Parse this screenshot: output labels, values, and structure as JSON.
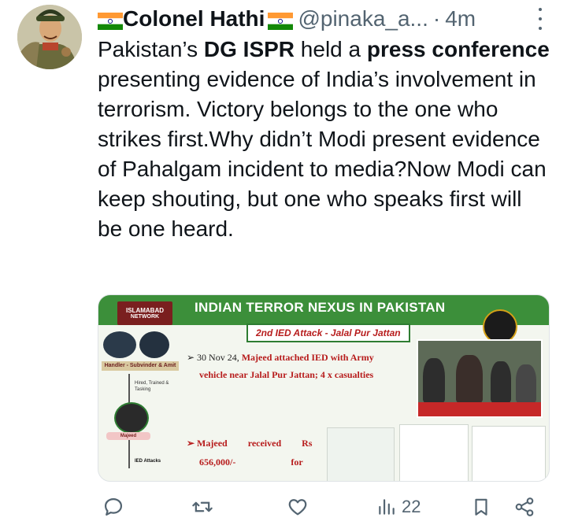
{
  "author": {
    "flag_left": "india-flag",
    "name": "Colonel Hathi",
    "flag_right": "india-flag",
    "handle": "@pinaka_a...",
    "separator": "·",
    "time": "4m"
  },
  "tweet": {
    "part1": "Pakistan’s ",
    "bold1": "DG ISPR",
    "part2": " held a ",
    "bold2": "press conference",
    "part3": " presenting evidence of India’s involvement in terrorism. Victory belongs to the one who strikes first.Why didn’t Modi present evidence of Pahalgam incident to media?Now Modi can keep shouting, but one who speaks first will be one heard."
  },
  "media": {
    "title": "INDIAN TERROR NEXUS IN PAKISTAN",
    "subtitle": "2nd IED Attack - Jalal Pur Jattan",
    "badge_line1": "ISLAMABAD",
    "badge_line2": "NETWORK",
    "handler_label": "Handler - Subvinder & Amit",
    "hired_label": "Hired, Trained & Tasking",
    "majeed_label": "Majeed",
    "ied_label": "IED Attacks",
    "bullet1_line1_prefix": "➢ 30 Nov 24, ",
    "bullet1_highlight": "Majeed attached IED with Army",
    "bullet1_line2": "vehicle near Jalal Pur Jattan; 4 x casualties",
    "bullet2_line1_a": "➢ Majeed",
    "bullet2_line1_b": "received",
    "bullet2_line1_c": "Rs",
    "bullet2_line2_a": "656,000/-",
    "bullet2_line2_b": "for"
  },
  "actions": {
    "reply_icon": "reply-icon",
    "retweet_icon": "retweet-icon",
    "like_icon": "heart-icon",
    "views_icon": "views-icon",
    "views_count": "22",
    "bookmark_icon": "bookmark-icon",
    "share_icon": "share-icon"
  },
  "colors": {
    "text": "#0f1419",
    "muted": "#536471",
    "slide_green": "#3c8f3a",
    "slide_red": "#b71c1c"
  }
}
